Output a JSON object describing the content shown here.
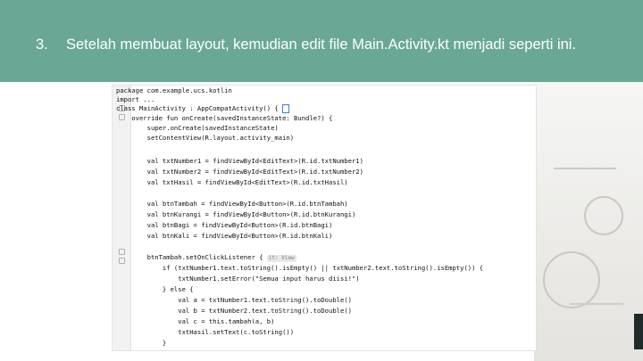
{
  "slide": {
    "number": "3.",
    "text": "Setelah membuat layout, kemudian edit file Main.Activity.kt menjadi seperti ini.",
    "colors": {
      "teal": "#6aa895",
      "white": "#ffffff"
    }
  },
  "code": {
    "lines": [
      "package com.example.ucs.kotlin",
      "import ...",
      "class MainActivity : AppCompatActivity() {",
      "    override fun onCreate(savedInstanceState: Bundle?) {",
      "        super.onCreate(savedInstanceState)",
      "        setContentView(R.layout.activity_main)",
      "",
      "        val txtNumber1 = findViewById<EditText>(R.id.txtNumber1)",
      "        val txtNumber2 = findViewById<EditText>(R.id.txtNumber2)",
      "        val txtHasil = findViewById<EditText>(R.id.txtHasil)",
      "",
      "        val btnTambah = findViewById<Button>(R.id.btnTambah)",
      "        val btnKurangi = findViewById<Button>(R.id.btnKurangi)",
      "        val btnBagi = findViewById<Button>(R.id.btnBagi)",
      "        val btnKali = findViewById<Button>(R.id.btnKali)",
      "",
      "        btnTambah.setOnClickListener {",
      "            if (txtNumber1.text.toString().isEmpty() || txtNumber2.text.toString().isEmpty()) {",
      "                txtNumber1.setError(\"Semua input harus diisi!\")",
      "            } else {",
      "                val a = txtNumber1.text.toString().toDouble()",
      "                val b = txtNumber2.text.toString().toDouble()",
      "                val c = this.tambah(a, b)",
      "                txtHasil.setText(c.toString())",
      "            }"
    ],
    "hint": "it: View"
  }
}
